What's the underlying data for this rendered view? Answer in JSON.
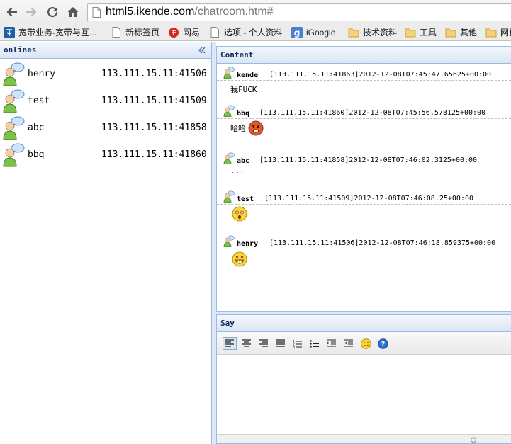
{
  "browser": {
    "url_host": "html5.ikende.com",
    "url_path": "/chatroom.htm#",
    "bookmarks": [
      {
        "label": "宽带业务-宽带与互...",
        "icon": "telecom-logo-icon"
      },
      {
        "label": "新标签页",
        "icon": "page-icon"
      },
      {
        "label": "网易",
        "icon": "netease-logo-icon"
      },
      {
        "label": "选项 - 个人资料",
        "icon": "page-icon"
      },
      {
        "label": "iGoogle",
        "icon": "google-logo-icon"
      },
      {
        "label": "技术资料",
        "icon": "folder-icon"
      },
      {
        "label": "工具",
        "icon": "folder-icon"
      },
      {
        "label": "其他",
        "icon": "folder-icon"
      },
      {
        "label": "网页",
        "icon": "folder-icon"
      }
    ]
  },
  "onlines": {
    "title": "onlines",
    "users": [
      {
        "name": "henry",
        "ip": "113.111.15.11:41506"
      },
      {
        "name": "test",
        "ip": "113.111.15.11:41509"
      },
      {
        "name": "abc",
        "ip": "113.111.15.11:41858"
      },
      {
        "name": "bbq",
        "ip": "113.111.15.11:41860"
      }
    ]
  },
  "content": {
    "title": "Content",
    "messages": [
      {
        "sender": "kende",
        "meta": "[113.111.15.11:41863]2012-12-08T07:45:47.65625+00:00",
        "text": "我FUCK",
        "emoticon": ""
      },
      {
        "sender": "bbq",
        "meta": "[113.111.15.11:41860]2012-12-08T07:45:56.578125+00:00",
        "text": "哈哈",
        "emoticon": "angry-face-emoticon"
      },
      {
        "sender": "abc",
        "meta": "[113.111.15.11:41858]2012-12-08T07:46:02.3125+00:00",
        "text": "...",
        "emoticon": ""
      },
      {
        "sender": "test",
        "meta": "[113.111.15.11:41509]2012-12-08T07:46:08.25+00:00",
        "text": "",
        "emoticon": "surprised-face-emoticon"
      },
      {
        "sender": "henry",
        "meta": "[113.111.15.11:41506]2012-12-08T07:46:18.859375+00:00",
        "text": "",
        "emoticon": "grinning-face-emoticon"
      }
    ]
  },
  "say": {
    "title": "Say",
    "toolbar": [
      "align-left-icon",
      "align-center-icon",
      "align-right-icon",
      "justify-icon",
      "ordered-list-icon",
      "unordered-list-icon",
      "indent-icon",
      "outdent-icon",
      "smiley-icon",
      "help-icon"
    ]
  }
}
